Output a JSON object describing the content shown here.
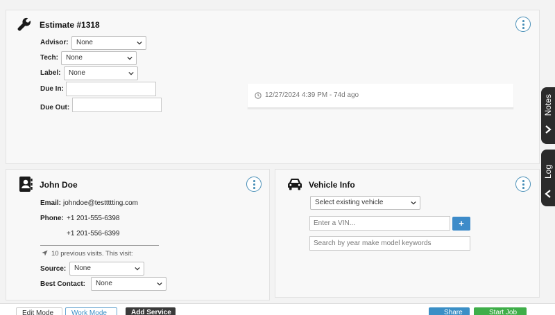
{
  "estimate": {
    "title": "Estimate #1318",
    "advisor_label": "Advisor:",
    "advisor_value": "None",
    "tech_label": "Tech:",
    "tech_value": "None",
    "label_label": "Label:",
    "label_value": "None",
    "due_in_label": "Due In:",
    "due_in_value": "",
    "due_out_label": "Due Out:",
    "due_out_value": "",
    "timestamp": "12/27/2024 4:39 PM - 74d ago"
  },
  "customer": {
    "name": "John Doe",
    "email_label": "Email:",
    "email": "johndoe@testtttting.com",
    "phone_label": "Phone:",
    "phones": [
      "+1 201-555-6398",
      "+1 201-556-6399"
    ],
    "visits_text": "10 previous visits. This visit:",
    "source_label": "Source:",
    "source_value": "None",
    "best_contact_label": "Best Contact:",
    "best_contact_value": "None"
  },
  "vehicle": {
    "title": "Vehicle Info",
    "select_value": "Select existing vehicle",
    "vin_placeholder": "Enter a VIN...",
    "add_label": "+",
    "search_placeholder": "Search by year make model keywords"
  },
  "side_tabs": {
    "notes": "Notes",
    "log": "Log"
  },
  "bottom_bar": {
    "edit_mode": "Edit Mode",
    "work_mode": "Work Mode",
    "add_service": "Add Service",
    "share": "Share",
    "start_job": "Start Job"
  },
  "colors": {
    "accent": "#4a90b8",
    "add_button": "#3d8bc9",
    "share": "#3b8fc6",
    "start_job": "#3fae49",
    "tab_dark": "#2b2b2b"
  }
}
